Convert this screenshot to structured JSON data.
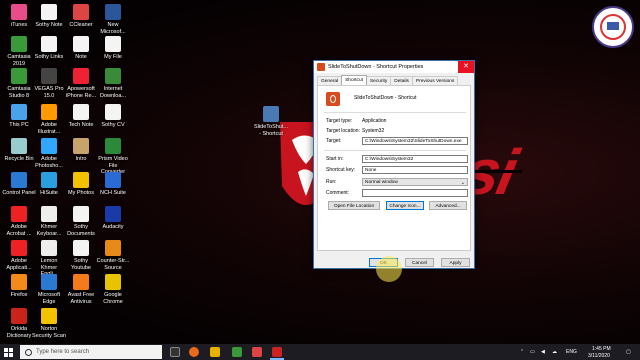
{
  "desktop": {
    "icons": [
      {
        "label": "iTunes",
        "color": "#e84d8a"
      },
      {
        "label": "Sothy Note",
        "color": "#f4f4f4"
      },
      {
        "label": "CCleaner",
        "color": "#d44"
      },
      {
        "label": "New\nMicrosof...",
        "color": "#2b579a"
      },
      {
        "label": "Camtasia\n2019",
        "color": "#3a9a3a"
      },
      {
        "label": "Sothy Links",
        "color": "#f4f4f4"
      },
      {
        "label": "Note",
        "color": "#f4f4f4"
      },
      {
        "label": "My File",
        "color": "#f4f4f4"
      },
      {
        "label": "Camtasia\nStudio 8",
        "color": "#3a9a3a"
      },
      {
        "label": "VEGAS Pro\n15.0",
        "color": "#444"
      },
      {
        "label": "Apowersoft\niPhone Re...",
        "color": "#e23"
      },
      {
        "label": "Internet\nDownloa...",
        "color": "#3a8a3a"
      },
      {
        "label": "This PC",
        "color": "#4aa3e8"
      },
      {
        "label": "Adobe\nIllustrat...",
        "color": "#ff9a00"
      },
      {
        "label": "Tech Note",
        "color": "#f4f4f4"
      },
      {
        "label": "Sothy CV",
        "color": "#f4f4f4"
      },
      {
        "label": "Recycle Bin",
        "color": "#9cc"
      },
      {
        "label": "Adobe\nPhotosho...",
        "color": "#31a8ff"
      },
      {
        "label": "Intro",
        "color": "#c6a46c"
      },
      {
        "label": "Prism Video\nFile Converter",
        "color": "#2a8a3a"
      },
      {
        "label": "Control Panel",
        "color": "#2a7ad4"
      },
      {
        "label": "HiSuite",
        "color": "#2aa0e0"
      },
      {
        "label": "My Photos",
        "color": "#f2c200"
      },
      {
        "label": "NCH Suite",
        "color": "#2a6ad4"
      },
      {
        "label": "Adobe\nAcrobat ...",
        "color": "#e22"
      },
      {
        "label": "Khmer\nKeyboar...",
        "color": "#eee"
      },
      {
        "label": "Sothy\nDocuments",
        "color": "#f4f4f4"
      },
      {
        "label": "Audacity",
        "color": "#1a3aa8"
      },
      {
        "label": "Adobe\nApplicati...",
        "color": "#e22"
      },
      {
        "label": "Lemon\nKhmer Engli...",
        "color": "#eee"
      },
      {
        "label": "Sothy\nYoutube",
        "color": "#f4f4f4"
      },
      {
        "label": "Counter-Str...\nSource",
        "color": "#e88a1a"
      },
      {
        "label": "Firefox",
        "color": "#f48a1a"
      },
      {
        "label": "Microsoft\nEdge",
        "color": "#2a7ad4"
      },
      {
        "label": "Avast Free\nAntivirus",
        "color": "#f47a1a"
      },
      {
        "label": "Google\nChrome",
        "color": "#e8c400"
      },
      {
        "label": "Orkida\nDictionary",
        "color": "#c8241a"
      },
      {
        "label": "Norton\nSecurity Scan",
        "color": "#f2c200"
      },
      {
        "label": "SlideToShut...\n- Shortcut",
        "color": "#4a7ab4"
      }
    ]
  },
  "dialog": {
    "title": "SlideToShutDown - Shortcut Properties",
    "close_label": "✕",
    "tabs": [
      "General",
      "Shortcut",
      "Security",
      "Details",
      "Previous Versions"
    ],
    "active_tab": "Shortcut",
    "name": "SlideToShutDown - Shortcut",
    "target_type_label": "Target type:",
    "target_type": "Application",
    "target_location_label": "Target location:",
    "target_location": "System32",
    "target_label": "Target:",
    "target": "C:\\Windows\\System32\\SlideToShutDown.exe",
    "start_in_label": "Start in:",
    "start_in": "C:\\Windows\\System32",
    "shortcut_key_label": "Shortcut key:",
    "shortcut_key": "None",
    "run_label": "Run:",
    "run": "Normal window",
    "comment_label": "Comment:",
    "comment": "",
    "open_file_location": "Open File Location",
    "change_icon": "Change Icon...",
    "advanced": "Advanced...",
    "ok": "OK",
    "cancel": "Cancel",
    "apply": "Apply"
  },
  "taskbar": {
    "search_placeholder": "Type here to search",
    "language": "ENG",
    "time": "1:45 PM",
    "date": "3/11/2020"
  }
}
